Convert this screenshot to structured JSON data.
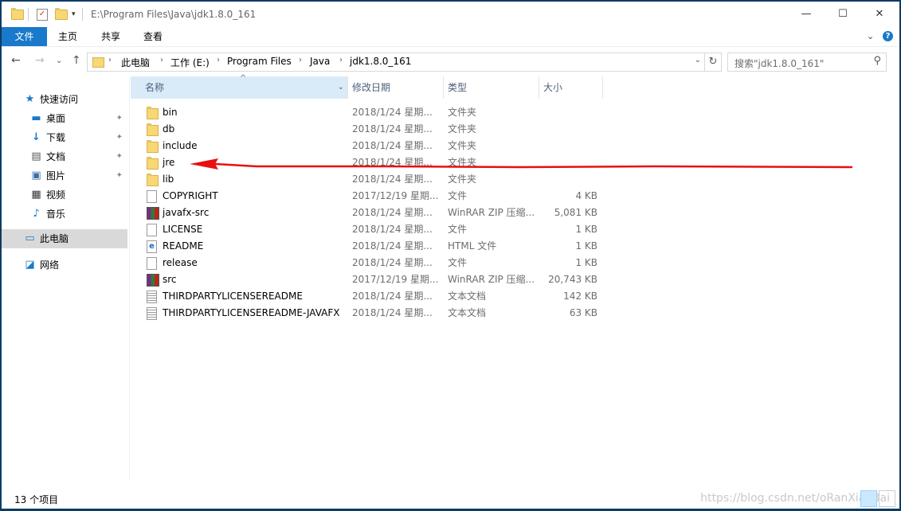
{
  "title_bar": {
    "path": "E:\\Program Files\\Java\\jdk1.8.0_161",
    "minimize": "—",
    "maximize": "☐",
    "close": "✕"
  },
  "ribbon": {
    "tabs": [
      "文件",
      "主页",
      "共享",
      "查看"
    ],
    "expand": "⌄",
    "help": "?"
  },
  "nav": {
    "back": "←",
    "forward": "→",
    "recent": "⌄",
    "up": "↑",
    "breadcrumbs": [
      "此电脑",
      "工作 (E:)",
      "Program Files",
      "Java",
      "jdk1.8.0_161"
    ],
    "search_placeholder": "搜索\"jdk1.8.0_161\""
  },
  "sidebar": {
    "quick_access": "快速访问",
    "items": [
      {
        "label": "桌面",
        "icon": "desktop-icon",
        "pinned": true
      },
      {
        "label": "下载",
        "icon": "download-icon",
        "pinned": true
      },
      {
        "label": "文档",
        "icon": "document-icon",
        "pinned": true
      },
      {
        "label": "图片",
        "icon": "picture-icon",
        "pinned": true
      },
      {
        "label": "视频",
        "icon": "video-icon",
        "pinned": false
      },
      {
        "label": "音乐",
        "icon": "music-icon",
        "pinned": false
      }
    ],
    "this_pc": "此电脑",
    "network": "网络"
  },
  "columns": {
    "name": "名称",
    "date": "修改日期",
    "type": "类型",
    "size": "大小"
  },
  "files": [
    {
      "name": "bin",
      "date": "2018/1/24 星期...",
      "type": "文件夹",
      "size": "",
      "icon": "folder"
    },
    {
      "name": "db",
      "date": "2018/1/24 星期...",
      "type": "文件夹",
      "size": "",
      "icon": "folder"
    },
    {
      "name": "include",
      "date": "2018/1/24 星期...",
      "type": "文件夹",
      "size": "",
      "icon": "folder"
    },
    {
      "name": "jre",
      "date": "2018/1/24 星期...",
      "type": "文件夹",
      "size": "",
      "icon": "folder"
    },
    {
      "name": "lib",
      "date": "2018/1/24 星期...",
      "type": "文件夹",
      "size": "",
      "icon": "folder"
    },
    {
      "name": "COPYRIGHT",
      "date": "2017/12/19 星期...",
      "type": "文件",
      "size": "4 KB",
      "icon": "file"
    },
    {
      "name": "javafx-src",
      "date": "2018/1/24 星期...",
      "type": "WinRAR ZIP 压缩...",
      "size": "5,081 KB",
      "icon": "zip"
    },
    {
      "name": "LICENSE",
      "date": "2018/1/24 星期...",
      "type": "文件",
      "size": "1 KB",
      "icon": "file"
    },
    {
      "name": "README",
      "date": "2018/1/24 星期...",
      "type": "HTML 文件",
      "size": "1 KB",
      "icon": "html"
    },
    {
      "name": "release",
      "date": "2018/1/24 星期...",
      "type": "文件",
      "size": "1 KB",
      "icon": "file"
    },
    {
      "name": "src",
      "date": "2017/12/19 星期...",
      "type": "WinRAR ZIP 压缩...",
      "size": "20,743 KB",
      "icon": "zip"
    },
    {
      "name": "THIRDPARTYLICENSEREADME",
      "date": "2018/1/24 星期...",
      "type": "文本文档",
      "size": "142 KB",
      "icon": "text"
    },
    {
      "name": "THIRDPARTYLICENSEREADME-JAVAFX",
      "date": "2018/1/24 星期...",
      "type": "文本文档",
      "size": "63 KB",
      "icon": "text"
    }
  ],
  "status": {
    "count": "13 个项目",
    "watermark": "https://blog.csdn.net/oRanXiaoBai"
  },
  "annotation": {
    "color": "#e8100f",
    "target": "jre"
  }
}
